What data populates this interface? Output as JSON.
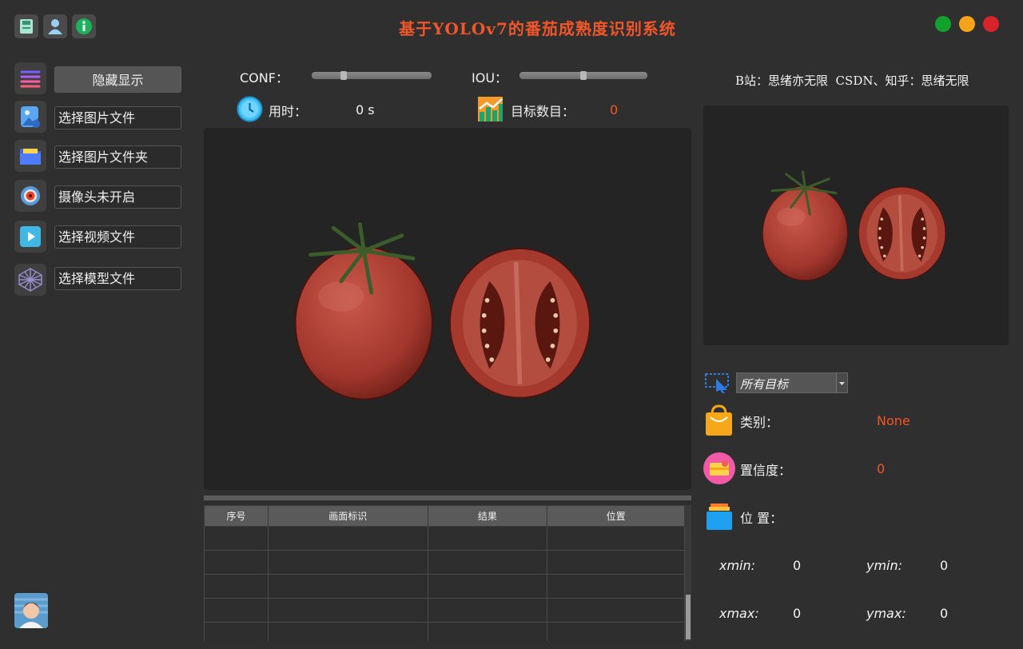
{
  "window": {
    "title": "基于YOLOv7的番茄成熟度识别系统",
    "top_icons": [
      "save-icon",
      "user-icon",
      "info-icon"
    ],
    "controls": {
      "minimize_color": "#12a12d",
      "maximize_color": "#f5a31a",
      "close_color": "#d9232a"
    }
  },
  "sidebar": {
    "toggle_label": "隐藏显示",
    "items": [
      {
        "label": "选择图片文件",
        "icon": "image-file-icon"
      },
      {
        "label": "选择图片文件夹",
        "icon": "folder-icon"
      },
      {
        "label": "摄像头未开启",
        "icon": "camera-icon"
      },
      {
        "label": "选择视频文件",
        "icon": "video-play-icon"
      },
      {
        "label": "选择模型文件",
        "icon": "model-network-icon"
      }
    ]
  },
  "params": {
    "conf_label": "CONF：",
    "conf_value": 0.25,
    "iou_label": "IOU：",
    "iou_value": 0.5,
    "time_label": "用时：",
    "time_value": "0 s",
    "count_label": "目标数目：",
    "count_value": "0"
  },
  "credit": "B站：思绪亦无限  CSDN、知乎：思绪无限",
  "table": {
    "headers": [
      "序号",
      "画面标识",
      "结果",
      "位置"
    ],
    "rows": 5
  },
  "detail": {
    "target_select": "所有目标",
    "class_label": "类别：",
    "class_value": "None",
    "conf_label": "置信度：",
    "conf_value": "0",
    "pos_label": "位 置：",
    "xmin_label": "xmin:",
    "xmin_value": "0",
    "ymin_label": "ymin:",
    "ymin_value": "0",
    "xmax_label": "xmax:",
    "xmax_value": "0",
    "ymax_label": "ymax:",
    "ymax_value": "0"
  },
  "colors": {
    "accent_orange": "#f0562a",
    "tomato_red": "#a8382c",
    "panel_bg": "#242424"
  }
}
